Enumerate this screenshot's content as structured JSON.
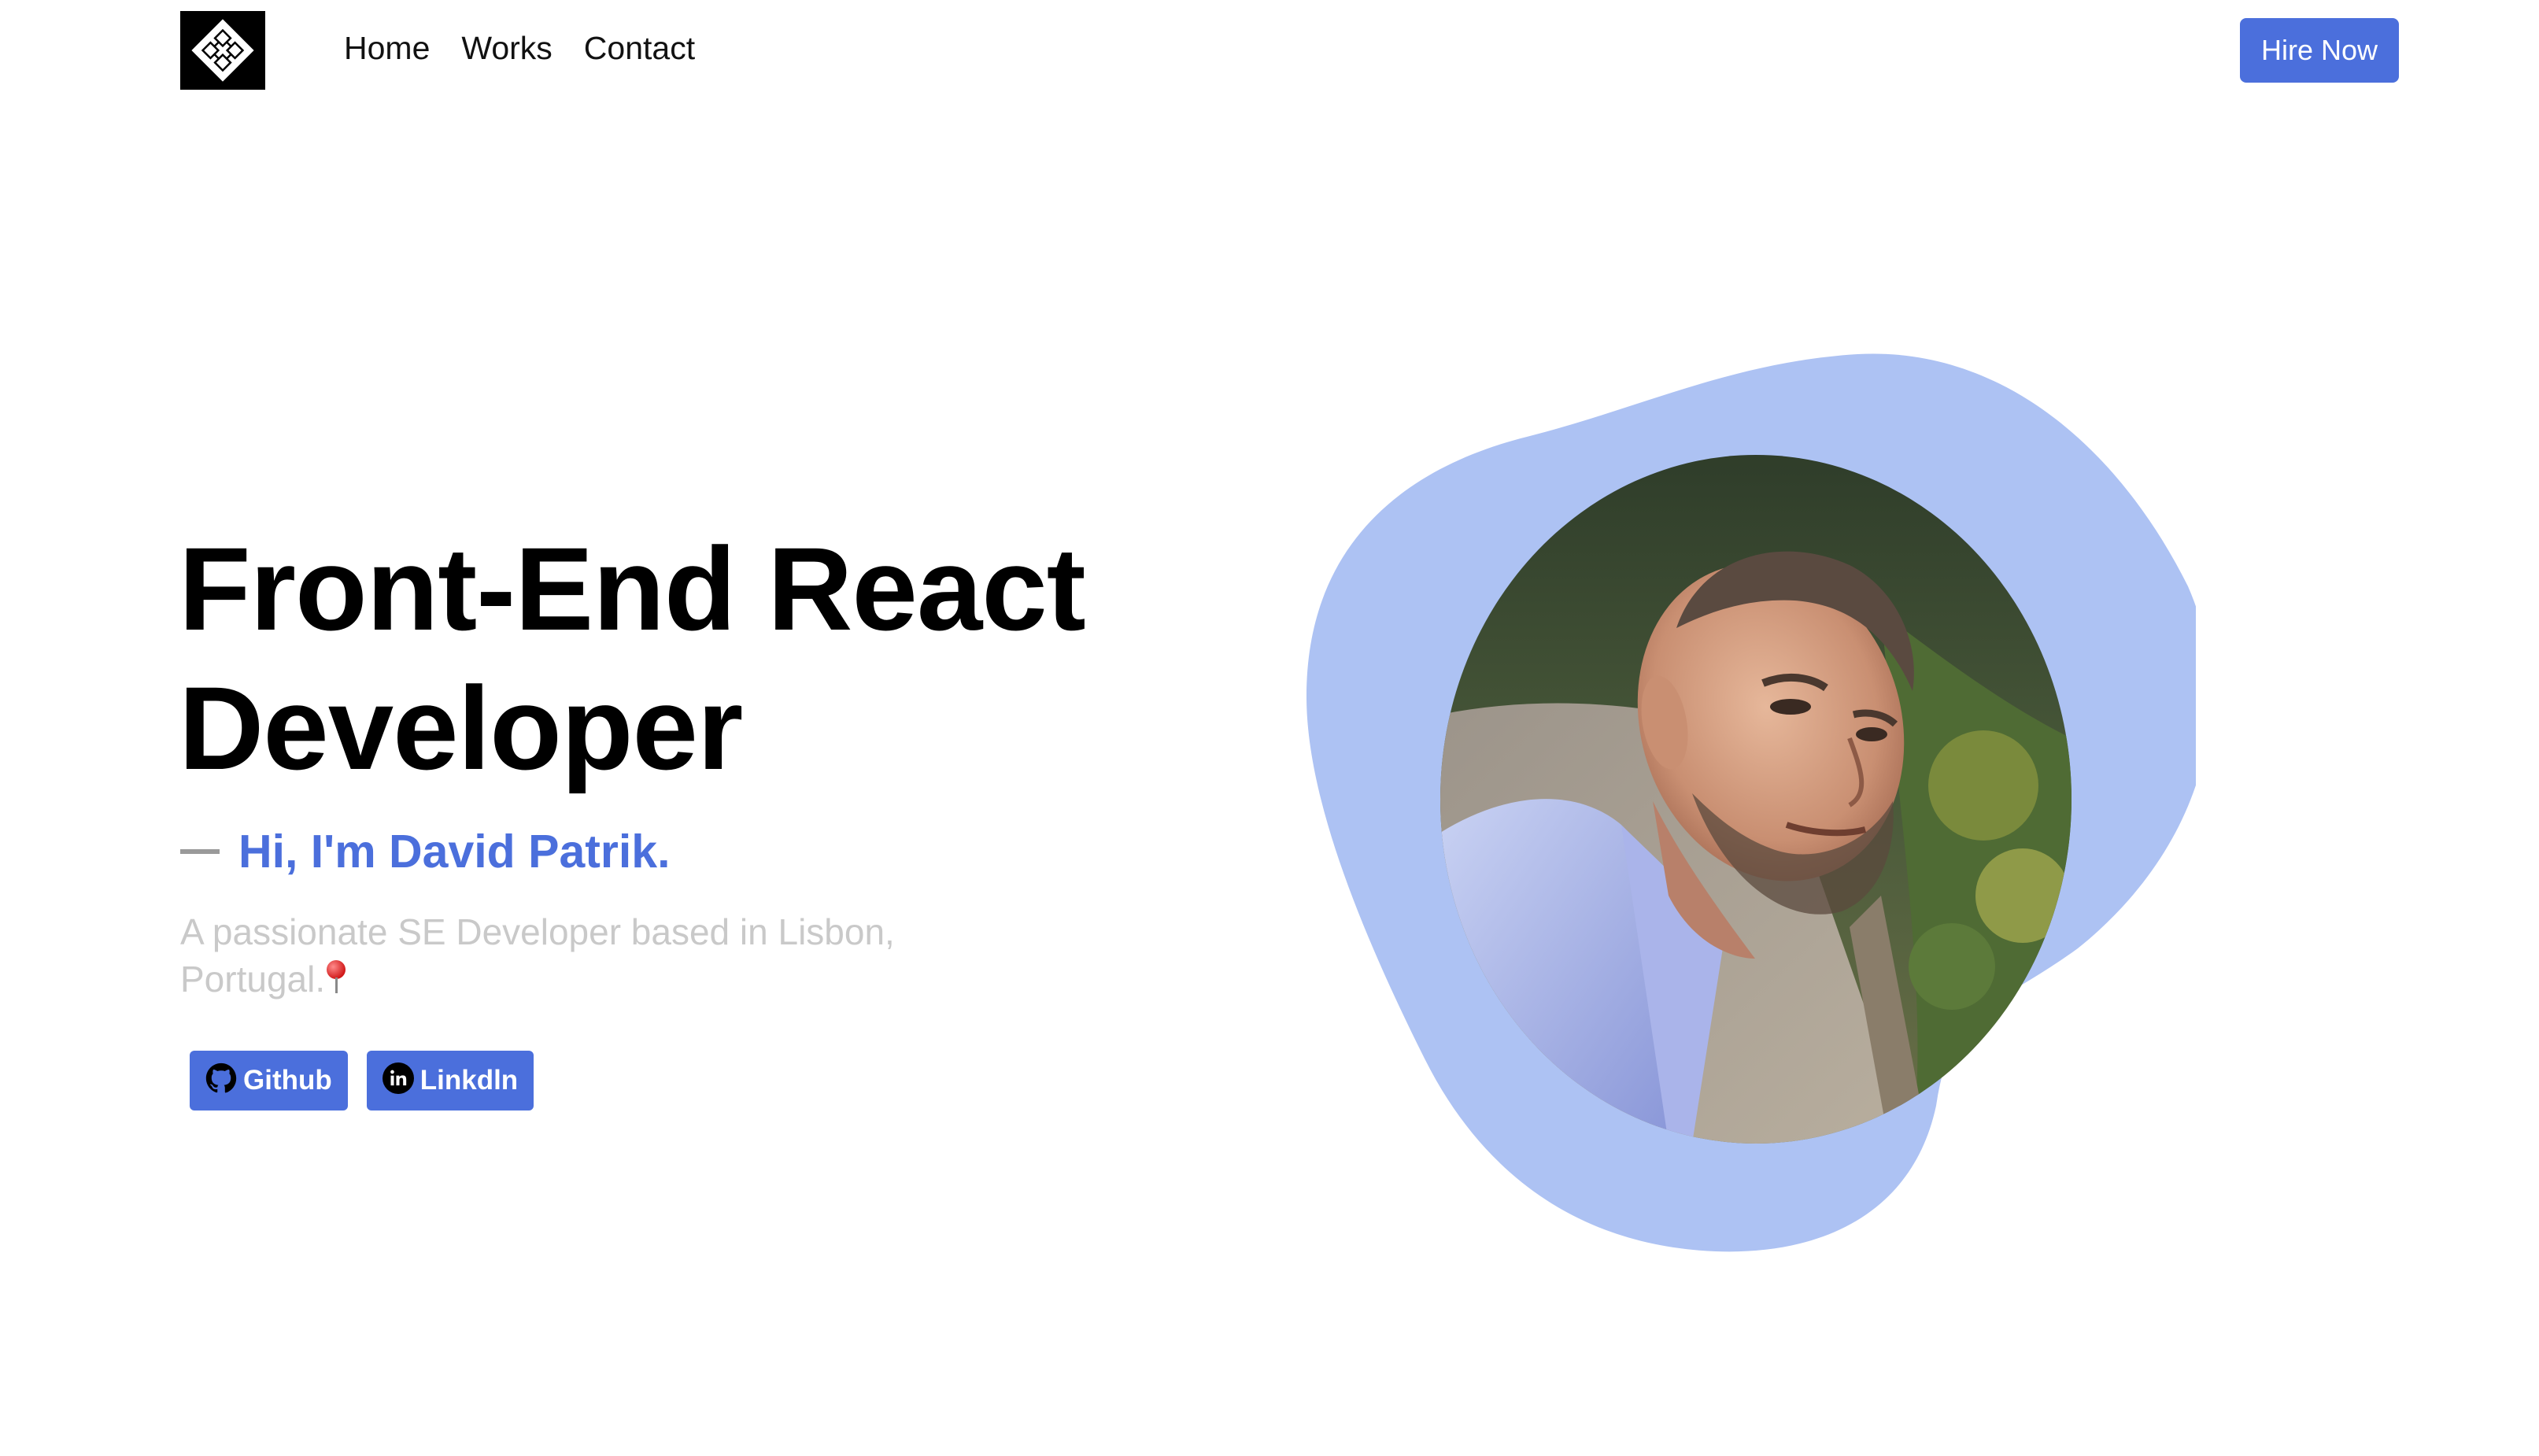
{
  "nav": {
    "logo_alt": "logo",
    "items": [
      {
        "label": "Home"
      },
      {
        "label": "Works"
      },
      {
        "label": "Contact"
      }
    ],
    "hire_label": "Hire Now"
  },
  "hero": {
    "headline_line1": "Front-End React",
    "headline_line2": "Developer",
    "intro": "Hi, I'm David Patrik.",
    "description": "A passionate SE Developer based in Lisbon, Portugal.",
    "socials": [
      {
        "label": "Github",
        "icon": "github-icon"
      },
      {
        "label": "Linkdln",
        "icon": "linkedin-icon"
      }
    ]
  },
  "colors": {
    "accent": "#4b6fdc",
    "blob": "#adc2f3",
    "muted_text": "#c9c9c9"
  }
}
